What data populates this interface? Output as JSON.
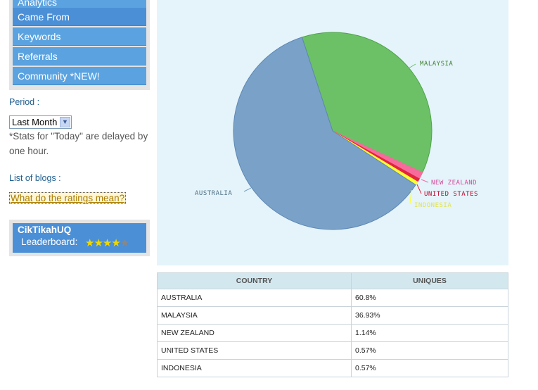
{
  "sidebar": {
    "items": [
      {
        "label": "Analytics"
      },
      {
        "label": "Came From"
      },
      {
        "label": "Keywords"
      },
      {
        "label": "Referrals"
      },
      {
        "label": "Community *NEW!"
      }
    ],
    "period_label": "Period :",
    "period_value": "Last Month",
    "note": "*Stats for \"Today\" are delayed by one hour.",
    "blogs_label": "List of blogs :",
    "ratings_link": "What do the ratings mean?",
    "leaderboard": {
      "name": "CikTikahUQ",
      "label": "Leaderboard:",
      "rating": 4,
      "max_rating": 5
    }
  },
  "chart_data": {
    "type": "pie",
    "categories": [
      "AUSTRALIA",
      "MALAYSIA",
      "NEW ZEALAND",
      "UNITED STATES",
      "INDONESIA"
    ],
    "values": [
      60.8,
      36.93,
      1.14,
      0.57,
      0.57
    ],
    "colors": [
      "#7aa1c8",
      "#6cc167",
      "#f76b9c",
      "#e2233f",
      "#ffff33"
    ],
    "label_colors": [
      "#4f6f86",
      "#3f7f2b",
      "#d5489b",
      "#c2002a",
      "#e3e34a"
    ]
  },
  "table": {
    "headers": [
      "COUNTRY",
      "UNIQUES"
    ],
    "rows": [
      [
        "AUSTRALIA",
        "60.8%"
      ],
      [
        "MALAYSIA",
        "36.93%"
      ],
      [
        "NEW ZEALAND",
        "1.14%"
      ],
      [
        "UNITED STATES",
        "0.57%"
      ],
      [
        "INDONESIA",
        "0.57%"
      ]
    ]
  }
}
